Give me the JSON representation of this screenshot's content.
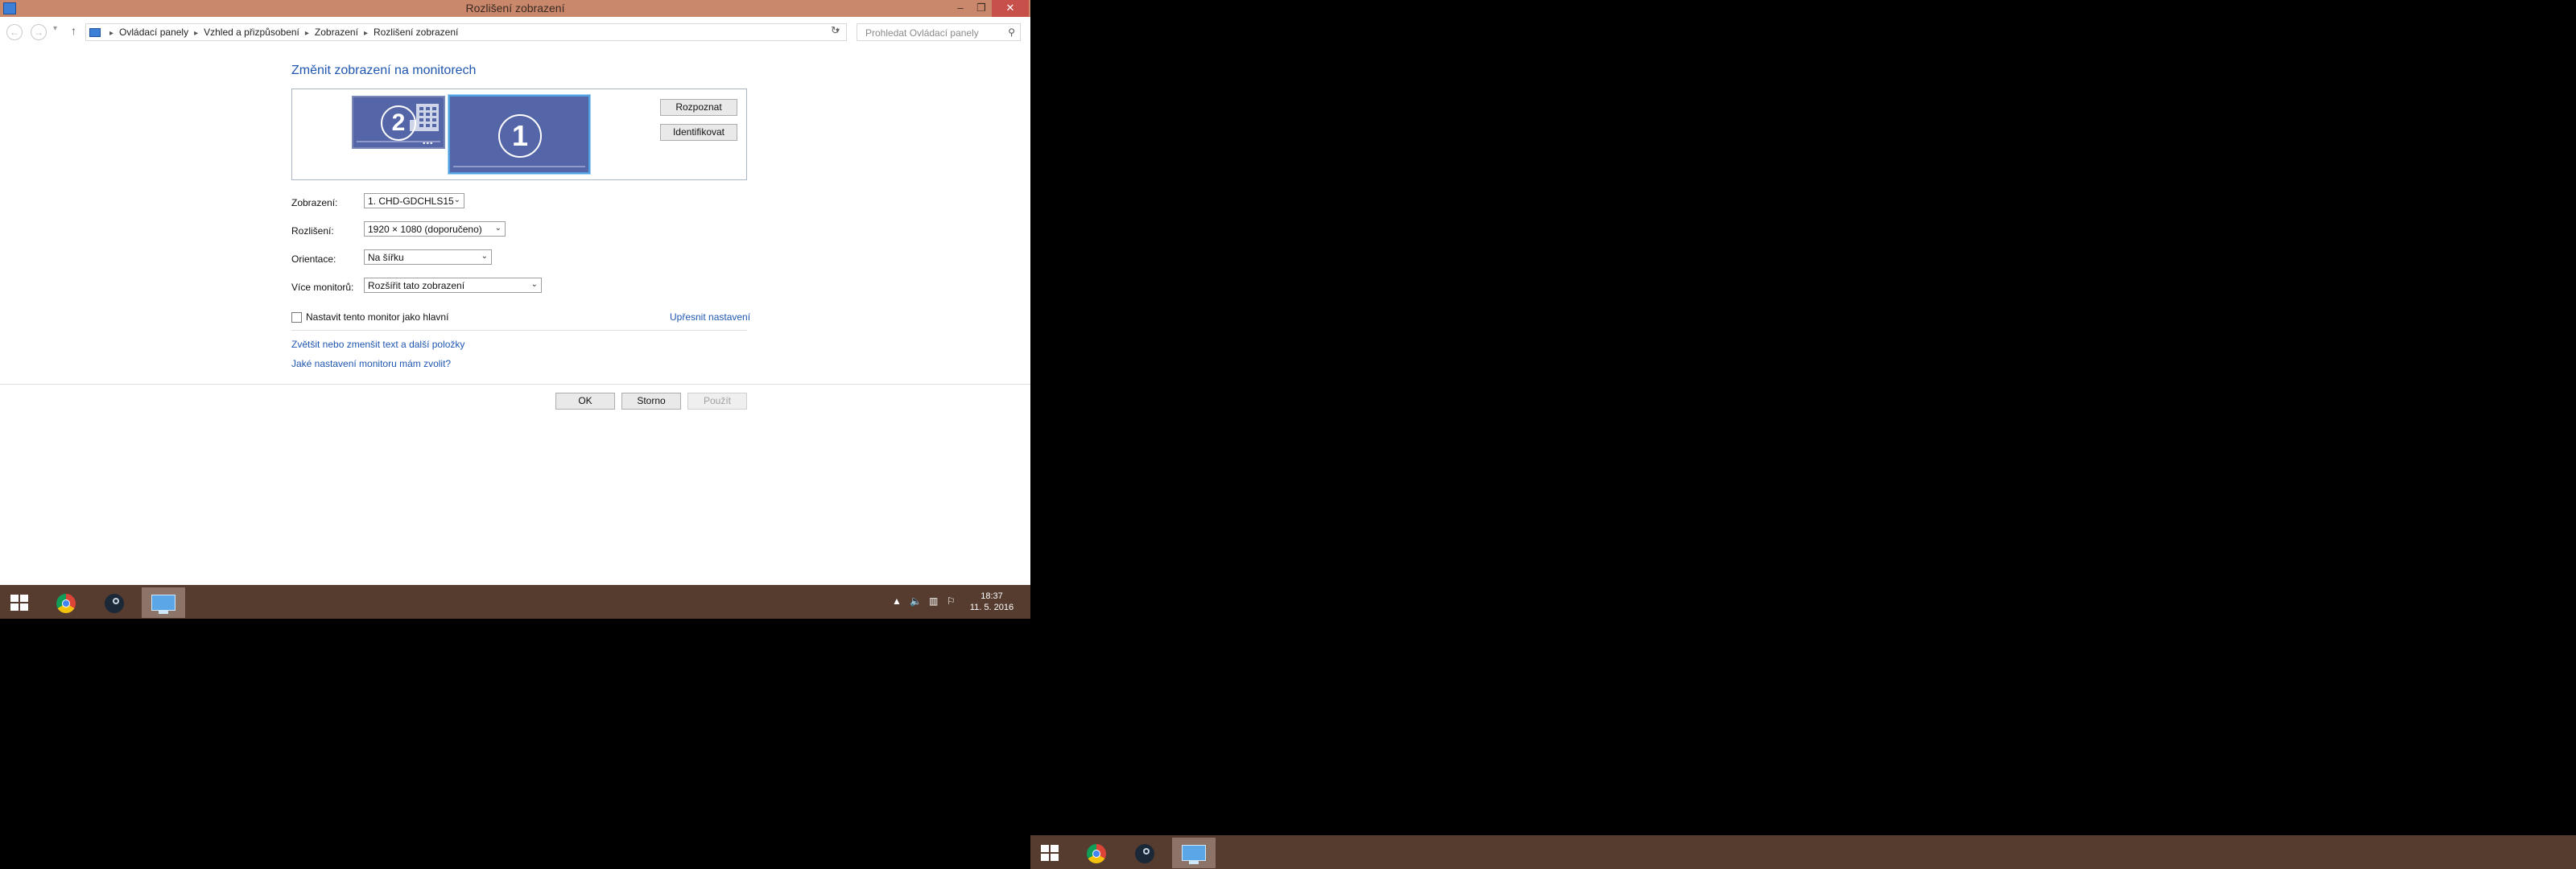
{
  "window": {
    "title": "Rozlišení zobrazení",
    "minimize": "‒",
    "maximize": "❐",
    "close": "✕"
  },
  "nav": {
    "back": "←",
    "forward": "→",
    "recent": "▾",
    "up": "↑",
    "refresh": "↻",
    "dropdown": "▾"
  },
  "breadcrumb": [
    "Ovládací panely",
    "Vzhled a přizpůsobení",
    "Zobrazení",
    "Rozlišení zobrazení"
  ],
  "search": {
    "placeholder": "Prohledat Ovládací panely",
    "icon": "⚲"
  },
  "main": {
    "heading": "Změnit zobrazení na monitorech",
    "monitors": [
      {
        "number": "2"
      },
      {
        "number": "1"
      }
    ],
    "detect_button": "Rozpoznat",
    "identify_button": "Identifikovat"
  },
  "fields": {
    "display_label": "Zobrazení:",
    "display_value": "1. CHD-GDCHLS15",
    "resolution_label": "Rozlišení:",
    "resolution_value": "1920 × 1080 (doporučeno)",
    "orientation_label": "Orientace:",
    "orientation_value": "Na šířku",
    "multi_label": "Více monitorů:",
    "multi_value": "Rozšířit tato zobrazení"
  },
  "primary_checkbox": {
    "label": "Nastavit tento monitor jako hlavní",
    "checked": false
  },
  "links": {
    "advanced": "Upřesnit nastavení",
    "text_size": "Zvětšit nebo zmenšit text a další položky",
    "which_settings": "Jaké nastavení monitoru mám zvolit?"
  },
  "buttons": {
    "ok": "OK",
    "cancel": "Storno",
    "apply": "Použít"
  },
  "taskbar": {
    "apps": [
      "start",
      "chrome",
      "steam",
      "display-settings"
    ],
    "tray": {
      "chevron": "▲",
      "volume": "🔈",
      "network": "▥",
      "flag": "⚐"
    },
    "time": "18:37",
    "date": "11. 5. 2016"
  },
  "colors": {
    "titlebar": "#c9876c",
    "close": "#c7504a",
    "taskbar": "#563c2f",
    "monitor": "#5566a8",
    "accent_link": "#1f56b0",
    "selected_monitor_border": "#52a0e0"
  }
}
